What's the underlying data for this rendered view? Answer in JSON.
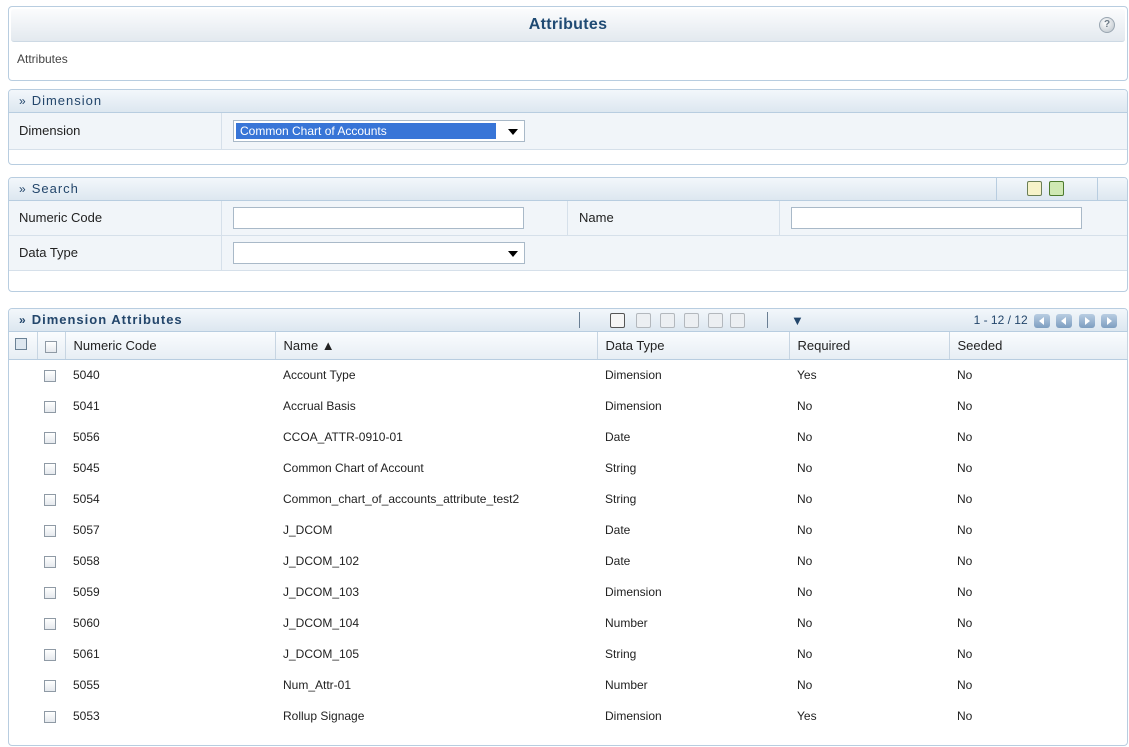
{
  "header": {
    "title": "Attributes",
    "breadcrumb": "Attributes",
    "help_icon": "question-icon"
  },
  "dimension_section": {
    "title": "Dimension",
    "label": "Dimension",
    "selected": "Common Chart of Accounts"
  },
  "search_section": {
    "title": "Search",
    "numeric_code_label": "Numeric Code",
    "numeric_code_value": "",
    "name_label": "Name",
    "name_value": "",
    "data_type_label": "Data Type",
    "data_type_value": ""
  },
  "attributes_section": {
    "title": "Dimension Attributes",
    "pagination": "1 - 12 / 12",
    "columns": {
      "numeric_code": "Numeric Code",
      "name": "Name ▲",
      "data_type": "Data Type",
      "required": "Required",
      "seeded": "Seeded"
    },
    "rows": [
      {
        "code": "5040",
        "name": "Account Type",
        "type": "Dimension",
        "required": "Yes",
        "seeded": "No"
      },
      {
        "code": "5041",
        "name": "Accrual Basis",
        "type": "Dimension",
        "required": "No",
        "seeded": "No"
      },
      {
        "code": "5056",
        "name": "CCOA_ATTR-0910-01",
        "type": "Date",
        "required": "No",
        "seeded": "No"
      },
      {
        "code": "5045",
        "name": "Common Chart of Account",
        "type": "String",
        "required": "No",
        "seeded": "No"
      },
      {
        "code": "5054",
        "name": "Common_chart_of_accounts_attribute_test2",
        "type": "String",
        "required": "No",
        "seeded": "No"
      },
      {
        "code": "5057",
        "name": "J_DCOM",
        "type": "Date",
        "required": "No",
        "seeded": "No"
      },
      {
        "code": "5058",
        "name": "J_DCOM_102",
        "type": "Date",
        "required": "No",
        "seeded": "No"
      },
      {
        "code": "5059",
        "name": "J_DCOM_103",
        "type": "Dimension",
        "required": "No",
        "seeded": "No"
      },
      {
        "code": "5060",
        "name": "J_DCOM_104",
        "type": "Number",
        "required": "No",
        "seeded": "No"
      },
      {
        "code": "5061",
        "name": "J_DCOM_105",
        "type": "String",
        "required": "No",
        "seeded": "No"
      },
      {
        "code": "5055",
        "name": "Num_Attr-01",
        "type": "Number",
        "required": "No",
        "seeded": "No"
      },
      {
        "code": "5053",
        "name": "Rollup Signage",
        "type": "Dimension",
        "required": "Yes",
        "seeded": "No"
      }
    ]
  }
}
